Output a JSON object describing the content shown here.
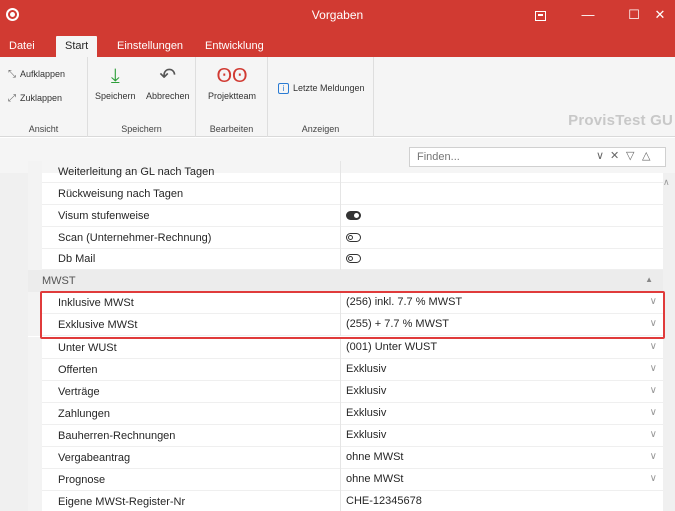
{
  "window": {
    "title": "Vorgaben",
    "ribbon_toggle_icon": "ribbon-display-icon",
    "minimize_glyph": "—",
    "maximize_glyph": "☐",
    "close_glyph": "✕"
  },
  "tabs": [
    {
      "label": "Datei"
    },
    {
      "label": "Start"
    },
    {
      "label": "Einstellungen"
    },
    {
      "label": "Entwicklung"
    }
  ],
  "ribbon": {
    "ansicht": {
      "label": "Ansicht",
      "expand": "Aufklappen",
      "collapse": "Zuklappen"
    },
    "speichern": {
      "label": "Speichern",
      "save": "Speichern",
      "cancel": "Abbrechen"
    },
    "bearbeiten": {
      "label": "Bearbeiten",
      "team": "Projektteam"
    },
    "anzeigen": {
      "label": "Anzeigen",
      "messages": "Letzte Meldungen"
    },
    "brand": "ProvisTest GU"
  },
  "search": {
    "placeholder": "Finden..."
  },
  "grid": {
    "partial_row": "Weiterleitung an GL nach Tagen",
    "rows_top": [
      {
        "name": "Rückweisung nach Tagen",
        "value": ""
      },
      {
        "name": "Visum stufenweise",
        "toggle": "on"
      },
      {
        "name": "Scan (Unternehmer-Rechnung)",
        "toggle": "off"
      },
      {
        "name": "Db Mail",
        "toggle": "off"
      }
    ],
    "section": "MWST",
    "rows": [
      {
        "name": "Inklusive MWSt",
        "value": "(256) inkl. 7.7 % MWST"
      },
      {
        "name": "Exklusive MWSt",
        "value": "(255) + 7.7 % MWST"
      },
      {
        "name": "Unter WUSt",
        "value": "(001) Unter WUST"
      },
      {
        "name": "Offerten",
        "value": "Exklusiv"
      },
      {
        "name": "Verträge",
        "value": "Exklusiv"
      },
      {
        "name": "Zahlungen",
        "value": "Exklusiv"
      },
      {
        "name": "Bauherren-Rechnungen",
        "value": "Exklusiv"
      },
      {
        "name": "Vergabeantrag",
        "value": "ohne MWSt"
      },
      {
        "name": "Prognose",
        "value": "ohne MWSt"
      },
      {
        "name": "Eigene MWSt-Register-Nr",
        "value": "CHE-12345678"
      }
    ]
  },
  "colors": {
    "accent": "#d13a32",
    "highlight": "#e03b3b"
  }
}
